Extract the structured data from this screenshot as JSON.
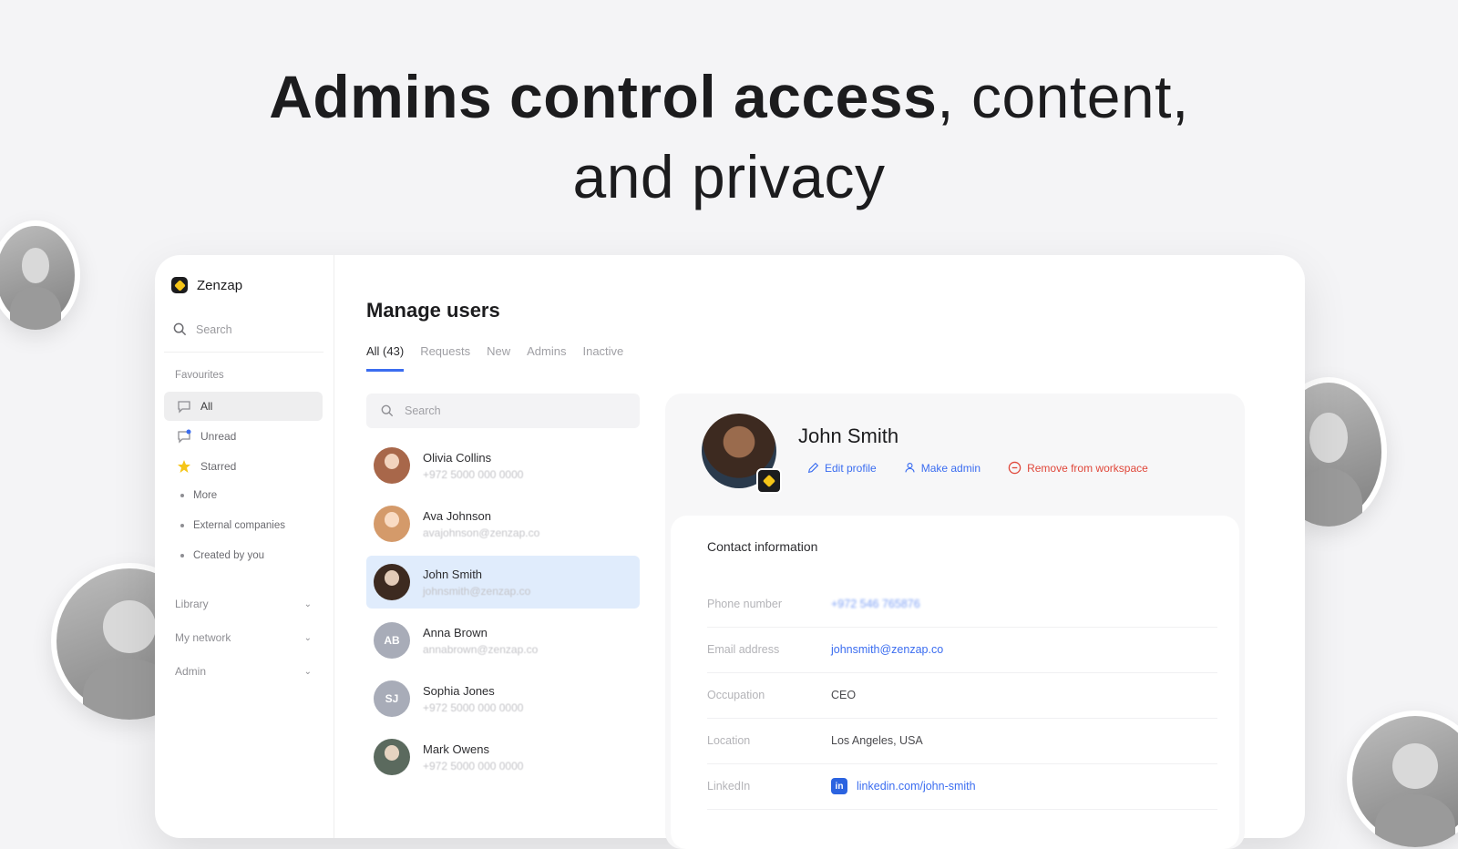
{
  "headline": {
    "strong": "Admins control access",
    "rest": ", content,",
    "line2": "and privacy"
  },
  "app": {
    "brand": "Zenzap",
    "sidebar": {
      "search_placeholder": "Search",
      "favourites_label": "Favourites",
      "items": [
        {
          "label": "All",
          "icon": "chat-icon",
          "active": true
        },
        {
          "label": "Unread",
          "icon": "unread-icon",
          "active": false
        },
        {
          "label": "Starred",
          "icon": "star-icon",
          "active": false
        }
      ],
      "sub_items": [
        "More",
        "External companies",
        "Created by you"
      ],
      "groups": [
        "Library",
        "My network",
        "Admin"
      ]
    },
    "main": {
      "title": "Manage users",
      "tabs": [
        {
          "label": "All (43)",
          "active": true
        },
        {
          "label": "Requests",
          "active": false
        },
        {
          "label": "New",
          "active": false
        },
        {
          "label": "Admins",
          "active": false
        },
        {
          "label": "Inactive",
          "active": false
        }
      ],
      "list_search_placeholder": "Search",
      "users": [
        {
          "name": "Olivia Collins",
          "sub": "+972 5000 000 0000",
          "avatar": "photo",
          "color": "#a8674a",
          "selected": false
        },
        {
          "name": "Ava Johnson",
          "sub": "avajohnson@zenzap.co",
          "avatar": "photo",
          "color": "#d49a6a",
          "selected": false
        },
        {
          "name": "John Smith",
          "sub": "johnsmith@zenzap.co",
          "avatar": "photo",
          "color": "#3d2a20",
          "selected": true
        },
        {
          "name": "Anna Brown",
          "sub": "annabrown@zenzap.co",
          "avatar": "initials",
          "initials": "AB",
          "selected": false
        },
        {
          "name": "Sophia Jones",
          "sub": "+972 5000 000 0000",
          "avatar": "initials",
          "initials": "SJ",
          "selected": false
        },
        {
          "name": "Mark Owens",
          "sub": "+972 5000 000 0000",
          "avatar": "photo",
          "color": "#5b6a5e",
          "selected": false
        }
      ]
    },
    "detail": {
      "name": "John Smith",
      "actions": {
        "edit": "Edit profile",
        "make_admin": "Make admin",
        "remove": "Remove from workspace"
      },
      "contact": {
        "title": "Contact information",
        "rows": [
          {
            "label": "Phone number",
            "value": "+972 546 765876",
            "style": "blur"
          },
          {
            "label": "Email address",
            "value": "johnsmith@zenzap.co",
            "style": "link"
          },
          {
            "label": "Occupation",
            "value": "CEO",
            "style": "plain"
          },
          {
            "label": "Location",
            "value": "Los Angeles, USA",
            "style": "plain"
          },
          {
            "label": "LinkedIn",
            "value": "linkedin.com/john-smith",
            "style": "linkedin"
          }
        ]
      }
    }
  },
  "colors": {
    "accent": "#3b6df0",
    "danger": "#e0473a",
    "selected_row": "#e0ecfc"
  }
}
